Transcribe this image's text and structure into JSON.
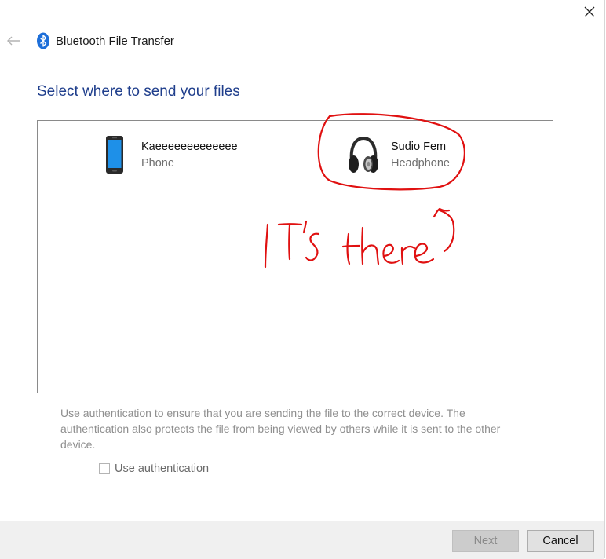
{
  "window": {
    "title": "Bluetooth File Transfer",
    "icons": {
      "close": "close-icon",
      "back": "back-arrow-icon",
      "app": "bluetooth-icon"
    }
  },
  "page": {
    "heading": "Select where to send your files"
  },
  "devices": [
    {
      "name": "Kaeeeeeeeeeeeee",
      "type": "Phone",
      "icon": "phone-icon"
    },
    {
      "name": "Sudio Fem",
      "type": "Headphone",
      "icon": "headphone-icon"
    }
  ],
  "annotation": {
    "text": "IT's there",
    "color": "#e01010"
  },
  "auth": {
    "description": "Use authentication to ensure that you are sending the file to the correct device. The authentication also protects the file from being viewed by others while it is sent to the other device.",
    "checkbox_label": "Use authentication",
    "checked": false
  },
  "buttons": {
    "next": "Next",
    "cancel": "Cancel"
  },
  "colors": {
    "heading": "#1f3e8c",
    "bluetooth": "#1e6fd9",
    "annotation": "#e01010"
  }
}
